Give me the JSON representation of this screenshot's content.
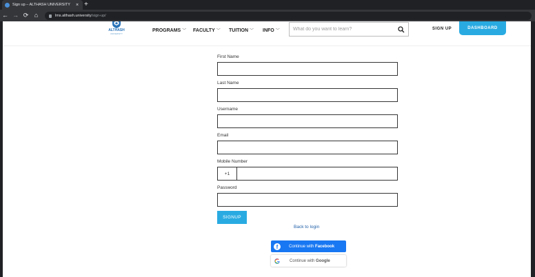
{
  "browser": {
    "tab_title": "Sign up – ALTHASH UNIVERSITY",
    "tab_close": "×",
    "new_tab": "+",
    "url_host": "lms.althash.university",
    "url_path": "/sign-up/"
  },
  "header": {
    "logo_text": "ALTHASH",
    "logo_sub": "UNIVERSITY",
    "nav": [
      "PROGRAMS",
      "FACULTY",
      "TUITION",
      "INFO"
    ],
    "search_placeholder": "What do you want to learn?",
    "signup_label": "SIGN UP",
    "dashboard_label": "DASHBOARD"
  },
  "form": {
    "first_name_label": "First Name",
    "last_name_label": "Last Name",
    "username_label": "Username",
    "email_label": "Email",
    "mobile_label": "Mobile Number",
    "country_code": "+1",
    "password_label": "Password",
    "submit_label": "SIGNUP",
    "back_link": "Back to login"
  },
  "social": {
    "facebook_prefix": "Continue with ",
    "facebook_name": "Facebook",
    "google_prefix": "Continue with ",
    "google_name": "Google"
  },
  "colors": {
    "accent": "#29abe2",
    "facebook": "#1877f2",
    "link": "#1f5fa8"
  },
  "icons": [
    "althash-logo-icon",
    "chevron-down-icon",
    "search-icon",
    "facebook-icon",
    "google-icon",
    "lock-icon",
    "back-icon",
    "forward-icon",
    "reload-icon",
    "home-icon"
  ]
}
